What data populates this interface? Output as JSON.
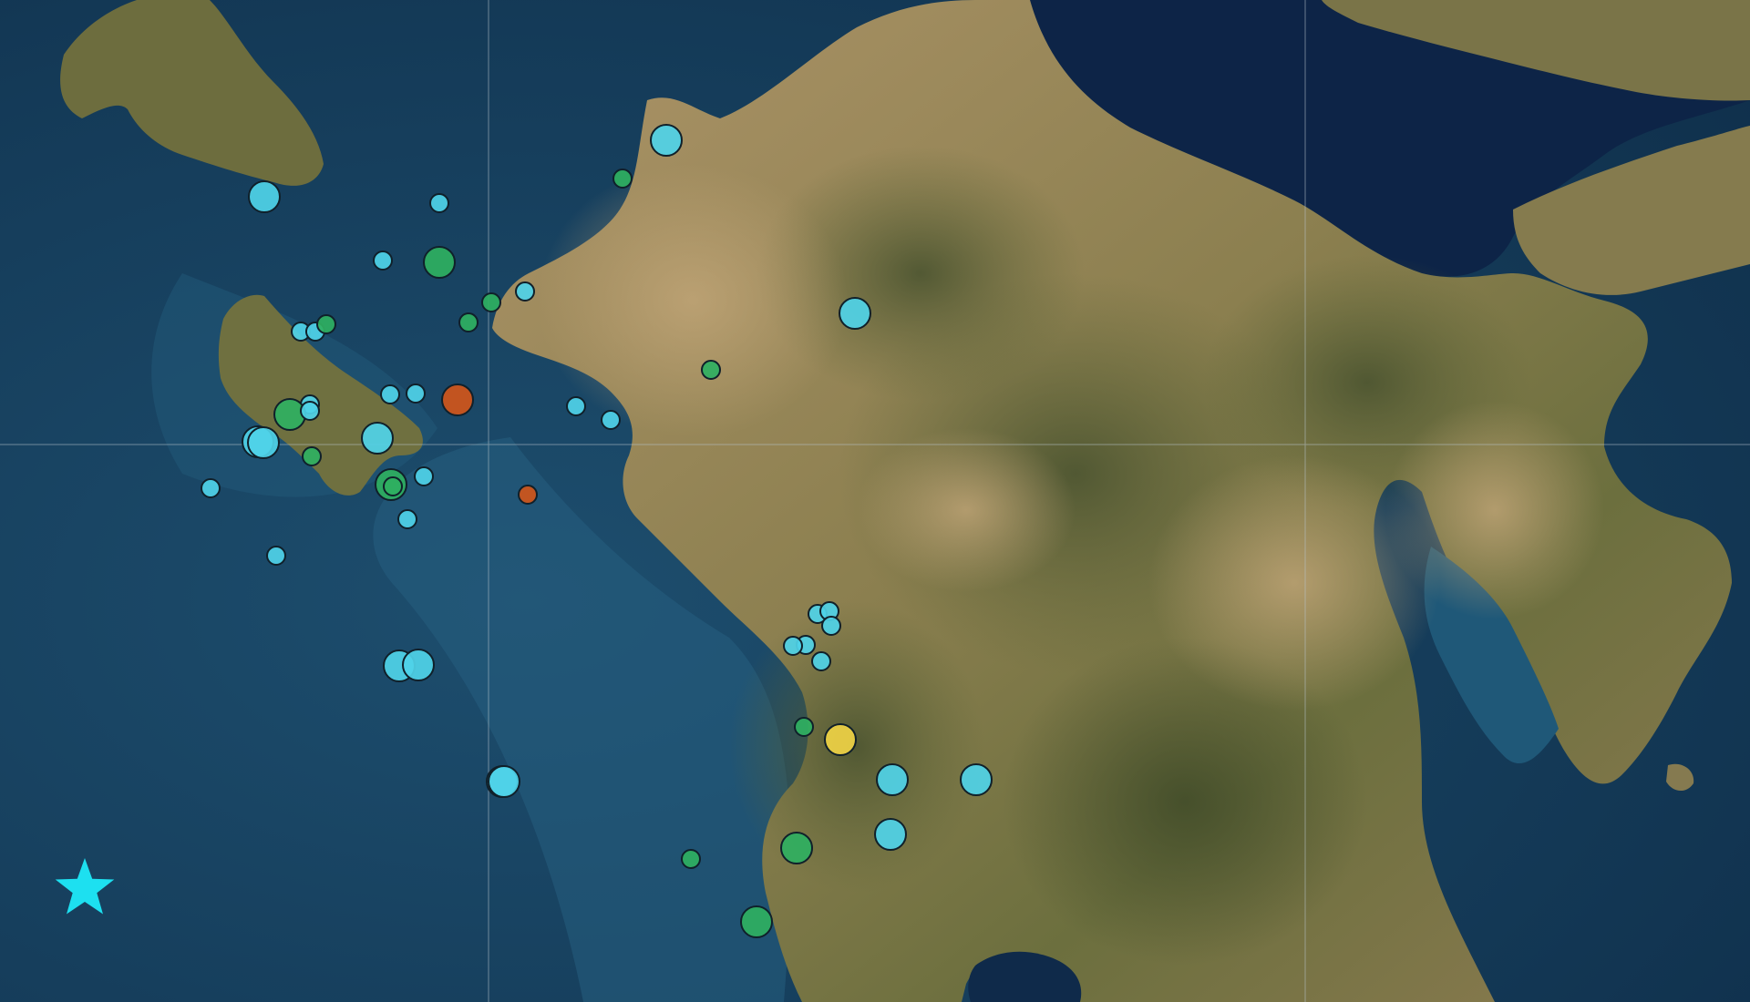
{
  "map": {
    "base_layer": "satellite",
    "colors": {
      "sea_deep": "#123652",
      "sea_shallow": "#255f7e",
      "gulf": "#0e2648",
      "land_dry": "#a98f62",
      "land_green": "#6f7a45",
      "land_dark": "#4c5530",
      "gridline": "#b8c4cc"
    }
  },
  "legend_colors": {
    "cyan": "#4fd3e8",
    "green": "#2fb061",
    "orange": "#d0561a",
    "yellow": "#efd245"
  },
  "epicenter": {
    "icon": "star-icon",
    "color": "#1de0f0"
  },
  "events": [
    {
      "c": "cyan",
      "s": "m"
    },
    {
      "c": "green",
      "s": "s"
    },
    {
      "c": "cyan",
      "s": "m"
    },
    {
      "c": "cyan",
      "s": "s"
    },
    {
      "c": "cyan",
      "s": "s"
    },
    {
      "c": "green",
      "s": "m"
    },
    {
      "c": "green",
      "s": "s"
    },
    {
      "c": "cyan",
      "s": "s"
    },
    {
      "c": "green",
      "s": "s"
    },
    {
      "c": "cyan",
      "s": "s"
    },
    {
      "c": "cyan",
      "s": "s"
    },
    {
      "c": "green",
      "s": "s"
    },
    {
      "c": "cyan",
      "s": "s"
    },
    {
      "c": "cyan",
      "s": "s"
    },
    {
      "c": "cyan",
      "s": "s"
    },
    {
      "c": "orange",
      "s": "m"
    },
    {
      "c": "green",
      "s": "m"
    },
    {
      "c": "cyan",
      "s": "s"
    },
    {
      "c": "cyan",
      "s": "m"
    },
    {
      "c": "cyan",
      "s": "m"
    },
    {
      "c": "cyan",
      "s": "m"
    },
    {
      "c": "green",
      "s": "s"
    },
    {
      "c": "cyan",
      "s": "s"
    },
    {
      "c": "green",
      "s": "m"
    },
    {
      "c": "green",
      "s": "s"
    },
    {
      "c": "cyan",
      "s": "s"
    },
    {
      "c": "cyan",
      "s": "s"
    },
    {
      "c": "orange",
      "s": "s"
    },
    {
      "c": "cyan",
      "s": "s"
    },
    {
      "c": "cyan",
      "s": "m"
    },
    {
      "c": "cyan",
      "s": "m"
    },
    {
      "c": "cyan",
      "s": "m"
    },
    {
      "c": "cyan",
      "s": "m"
    },
    {
      "c": "green",
      "s": "s"
    },
    {
      "c": "cyan",
      "s": "s"
    },
    {
      "c": "cyan",
      "s": "s"
    },
    {
      "c": "cyan",
      "s": "m"
    },
    {
      "c": "cyan",
      "s": "s"
    },
    {
      "c": "cyan",
      "s": "s"
    },
    {
      "c": "cyan",
      "s": "s"
    },
    {
      "c": "cyan",
      "s": "s"
    },
    {
      "c": "cyan",
      "s": "s"
    },
    {
      "c": "cyan",
      "s": "s"
    },
    {
      "c": "green",
      "s": "s"
    },
    {
      "c": "yellow",
      "s": "m"
    },
    {
      "c": "cyan",
      "s": "m"
    },
    {
      "c": "cyan",
      "s": "m"
    },
    {
      "c": "green",
      "s": "m"
    },
    {
      "c": "cyan",
      "s": "m"
    },
    {
      "c": "green",
      "s": "s"
    },
    {
      "c": "green",
      "s": "m"
    }
  ]
}
